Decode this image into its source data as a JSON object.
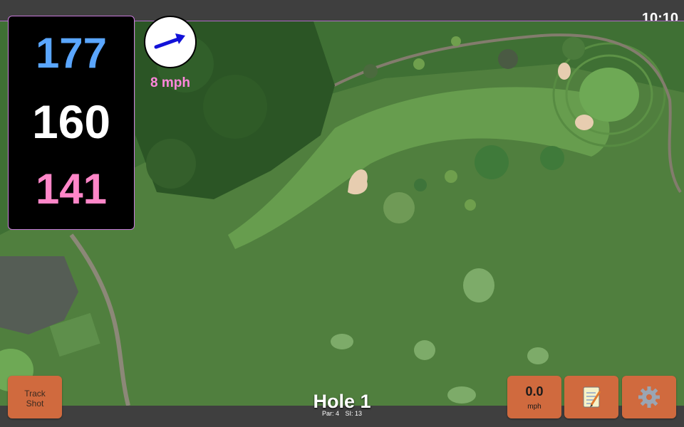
{
  "status_bar": {
    "time": "10:10"
  },
  "distances": {
    "back": "177",
    "center": "160",
    "front": "141"
  },
  "wind": {
    "speed": "8 mph",
    "direction_icon": "wind-arrow-icon"
  },
  "hole": {
    "title": "Hole 1",
    "par": "Par: 4",
    "stroke_index": "SI: 13"
  },
  "buttons": {
    "track_line1": "Track",
    "track_line2": "Shot",
    "speed_value": "0.0",
    "speed_unit": "mph",
    "notes_icon": "notepad-icon",
    "settings_icon": "gear-icon"
  },
  "colors": {
    "back_distance": "#5aa6ff",
    "center_distance": "#ffffff",
    "front_distance": "#ff86c8",
    "wind_text": "#ff86dc",
    "button_bg": "#d06a3e"
  }
}
